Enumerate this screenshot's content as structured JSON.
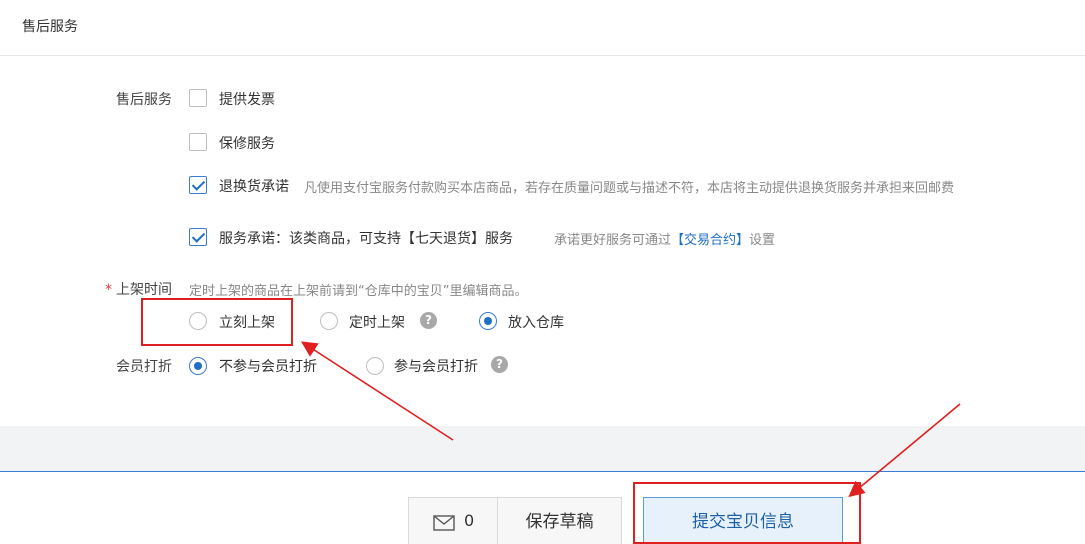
{
  "section": {
    "title": "售后服务"
  },
  "after_sales": {
    "label": "售后服务",
    "invoice_label": "提供发票",
    "invoice_checked": false,
    "warranty_label": "保修服务",
    "warranty_checked": false,
    "return_label": "退换货承诺",
    "return_checked": true,
    "return_hint": "凡使用支付宝服务付款购买本店商品，若存在质量问题或与描述不符，本店将主动提供退换货服务并承担来回邮费",
    "service_label": "服务承诺：该类商品，可支持【七天退货】服务",
    "service_checked": true,
    "service_hint_prefix": "承诺更好服务可通过",
    "service_hint_link": "【交易合约】",
    "service_hint_suffix": "设置"
  },
  "listing_time": {
    "required_mark": "*",
    "label": "上架时间",
    "hint": "定时上架的商品在上架前请到“仓库中的宝贝”里编辑商品。",
    "options": [
      "立刻上架",
      "定时上架",
      "放入仓库"
    ],
    "selected": "放入仓库"
  },
  "member_discount": {
    "label": "会员打折",
    "options": [
      "不参与会员打折",
      "参与会员打折"
    ],
    "selected": "不参与会员打折"
  },
  "footer": {
    "message_count": "0",
    "save_draft_label": "保存草稿",
    "submit_label": "提交宝贝信息"
  },
  "colors": {
    "accent": "#1f6fc5",
    "annotation_red": "#e02020"
  }
}
